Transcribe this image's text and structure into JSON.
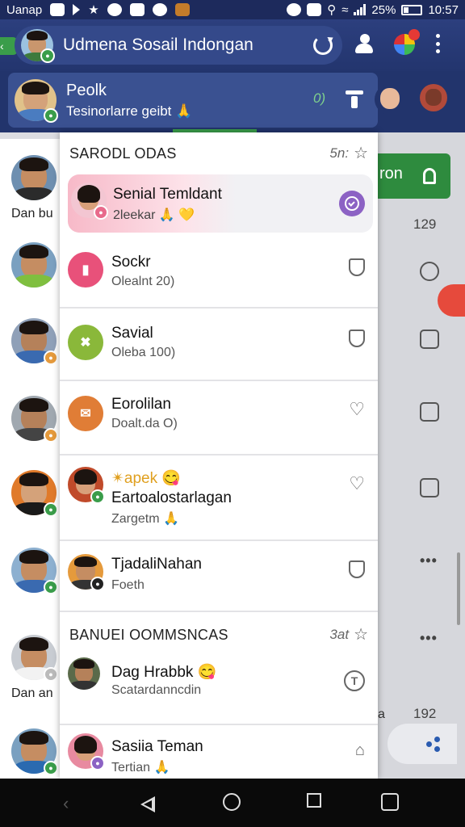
{
  "status_bar": {
    "carrier": "Uanap",
    "battery": "25%",
    "time": "10:57"
  },
  "app_bar": {
    "title": "Udmena Sosail Indongan"
  },
  "profile": {
    "name": "Peolk",
    "subtitle": "Tesinorlarre geibt 🙏",
    "count": "0)"
  },
  "popup": {
    "section1": {
      "title": "SARODL ODAS",
      "meta": "5n:"
    },
    "items1": [
      {
        "name": "Senial Temldant",
        "sub": "2leekar 🙏 💛",
        "color": "#e86a8c"
      },
      {
        "name": "Sockr",
        "sub": "Olealnt 20)",
        "color": "#e8517a"
      },
      {
        "name": "Savial",
        "sub": "Oleba 100)",
        "color": "#8ab83a"
      },
      {
        "name": "Eorolilan",
        "sub": "Doalt.da O)",
        "color": "#e07d36"
      },
      {
        "name": "Eartoalostarlagan",
        "tag": "✴apek 😋",
        "sub": "Zargetm 🙏",
        "color": "#c04a2a"
      },
      {
        "name": "TjadaliNahan",
        "sub": "Foeth",
        "color": "#e59a3c"
      }
    ],
    "section2": {
      "title": "BANUEI OOMMSNCAS",
      "meta": "3at"
    },
    "items2": [
      {
        "name": "Dag Hrabbk 😋",
        "sub": "Scatardanncdin",
        "trailing": "T"
      },
      {
        "name": "Sasiia Teman",
        "sub": "Tertian 🙏"
      }
    ]
  },
  "left_column": {
    "captions": [
      "Dan bu",
      "Dan an"
    ]
  },
  "right_column": {
    "button_label": "ron",
    "num_top": "129",
    "num_bottom": "192",
    "label_bottom": "a"
  },
  "colors": {
    "header_bg": "#23356e",
    "accent_green": "#2e8b3e",
    "accent_purple": "#8c62c4",
    "alert_red": "#e64a3c"
  }
}
